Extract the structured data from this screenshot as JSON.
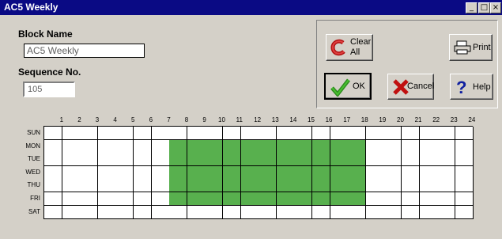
{
  "window": {
    "title": "AC5 Weekly",
    "controls": [
      "minimize",
      "maximize",
      "close"
    ]
  },
  "form": {
    "block_name_label": "Block Name",
    "block_name_value": "AC5 Weekly",
    "sequence_label": "Sequence No.",
    "sequence_value": "105"
  },
  "buttons": {
    "clear_all": "Clear All",
    "clear_all_line1": "Clear",
    "clear_all_line2": "All",
    "print": "Print",
    "ok": "OK",
    "cancel": "Cancel",
    "help": "Help"
  },
  "icons": {
    "clear_all": "clear-c-icon",
    "print": "printer-icon",
    "ok": "checkmark-icon",
    "cancel": "x-cancel-icon",
    "help": "question-mark-icon"
  },
  "schedule": {
    "hours": [
      "1",
      "2",
      "3",
      "4",
      "5",
      "6",
      "7",
      "8",
      "9",
      "10",
      "11",
      "12",
      "13",
      "14",
      "15",
      "16",
      "17",
      "18",
      "19",
      "20",
      "21",
      "22",
      "23",
      "24"
    ],
    "days": [
      "SUN",
      "MON",
      "TUE",
      "WED",
      "THU",
      "FRI",
      "SAT"
    ],
    "active": {
      "SUN": [],
      "MON": [
        8,
        9,
        10,
        11,
        12,
        13,
        14,
        15,
        16,
        17,
        18
      ],
      "TUE": [
        8,
        9,
        10,
        11,
        12,
        13,
        14,
        15,
        16,
        17,
        18
      ],
      "WED": [
        8,
        9,
        10,
        11,
        12,
        13,
        14,
        15,
        16,
        17,
        18
      ],
      "THU": [
        8,
        9,
        10,
        11,
        12,
        13,
        14,
        15,
        16,
        17,
        18
      ],
      "FRI": [
        8,
        9,
        10,
        11,
        12,
        13,
        14,
        15,
        16,
        17,
        18
      ],
      "SAT": []
    },
    "colors": {
      "active": "#58b04e",
      "inactive": "#ffffff",
      "grid": "#000000"
    }
  }
}
